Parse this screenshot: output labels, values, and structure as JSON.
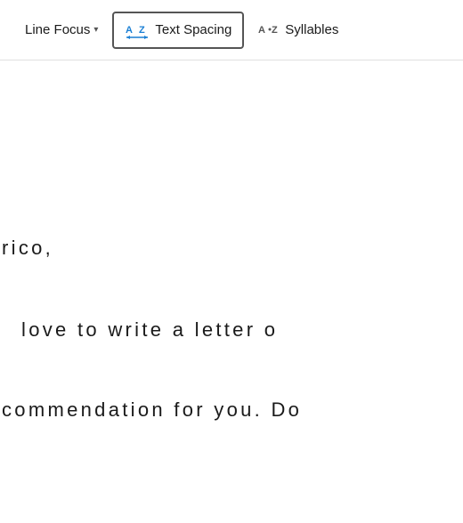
{
  "toolbar": {
    "lineFocus": {
      "label": "Line Focus",
      "hasDropdown": true
    },
    "textSpacing": {
      "label": "Text Spacing",
      "active": true
    },
    "syllables": {
      "label": "Syllables"
    }
  },
  "content": {
    "line1": "rico,",
    "line2": "love to write a letter o",
    "line3": "commendation for you. Do"
  },
  "colors": {
    "accent": "#1a7fd4",
    "border": "#555555",
    "text": "#1a1a1a"
  }
}
